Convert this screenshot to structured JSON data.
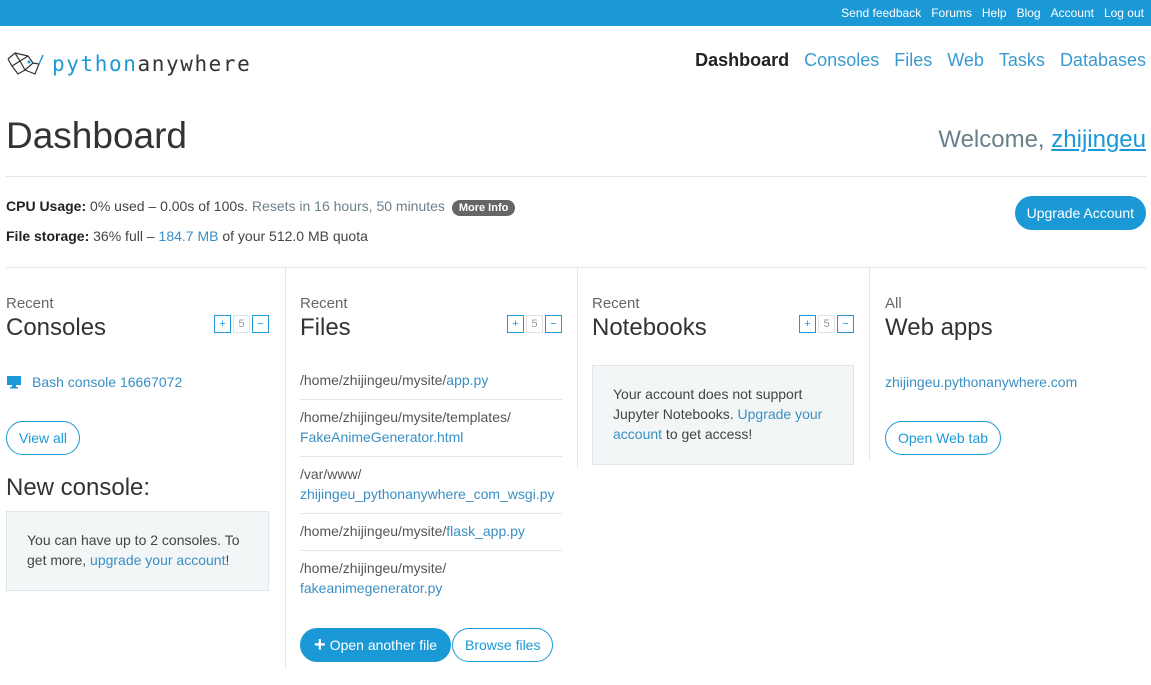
{
  "topbar": {
    "links": [
      "Send feedback",
      "Forums",
      "Help",
      "Blog",
      "Account",
      "Log out"
    ]
  },
  "logo": {
    "part1": "python",
    "part2": "anywhere"
  },
  "nav": {
    "dashboard": "Dashboard",
    "consoles": "Consoles",
    "files": "Files",
    "web": "Web",
    "tasks": "Tasks",
    "databases": "Databases"
  },
  "page_title": "Dashboard",
  "welcome": {
    "prefix": "Welcome, ",
    "username": "zhijingeu"
  },
  "cpu": {
    "label": "CPU Usage:",
    "used": "0% used",
    "dash": " – ",
    "amount": "0.00s of 100s.",
    "resets": " Resets in 16 hours, 50 minutes",
    "more_info": "More Info"
  },
  "storage": {
    "label": "File storage:",
    "pct": "36% full",
    "dash": " – ",
    "used": "184.7 MB",
    "rest": " of your 512.0 MB quota"
  },
  "upgrade_button": "Upgrade Account",
  "consoles_col": {
    "kicker": "Recent",
    "title": "Consoles",
    "stepper": {
      "plus": "+",
      "count": "5",
      "minus": "−"
    },
    "items": [
      "Bash console 16667072"
    ],
    "view_all": "View all",
    "new_console_title": "New console:",
    "limit_text": "You can have up to 2 consoles. To get more, ",
    "limit_link": "upgrade your account",
    "limit_end": "!"
  },
  "files_col": {
    "kicker": "Recent",
    "title": "Files",
    "stepper": {
      "plus": "+",
      "count": "5",
      "minus": "−"
    },
    "files": [
      {
        "dir": "/home/zhijingeu/mysite/",
        "name": "app.py"
      },
      {
        "dir": "/home/zhijingeu/mysite/templates/",
        "name": "FakeAnimeGenerator.html"
      },
      {
        "dir": "/var/www/",
        "name": "zhijingeu_pythonanywhere_com_wsgi.py"
      },
      {
        "dir": "/home/zhijingeu/mysite/",
        "name": "flask_app.py"
      },
      {
        "dir": "/home/zhijingeu/mysite/",
        "name": "fakeanimegenerator.py"
      }
    ],
    "open_another": "Open another file",
    "browse": "Browse files"
  },
  "notebooks_col": {
    "kicker": "Recent",
    "title": "Notebooks",
    "stepper": {
      "plus": "+",
      "count": "5",
      "minus": "−"
    },
    "msg_text": "Your account does not support Jupyter Notebooks. ",
    "msg_link": "Upgrade your account",
    "msg_end": " to get access!"
  },
  "webapps_col": {
    "kicker": "All",
    "title": "Web apps",
    "app": "zhijingeu.pythonanywhere.com",
    "open_tab": "Open Web tab"
  },
  "colors": {
    "brand": "#1b99d6",
    "link": "#3a8fc4",
    "infobox": "#f2f6f7"
  }
}
